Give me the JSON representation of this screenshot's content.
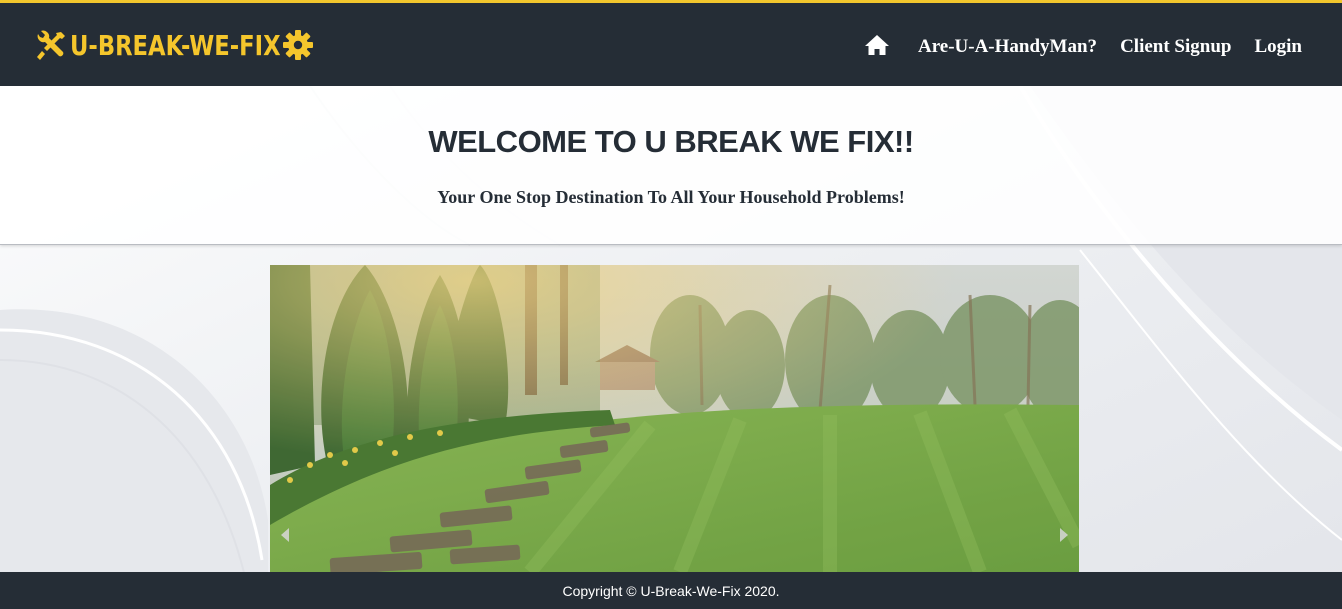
{
  "brand": {
    "name": "U-BREAK-WE-FIX",
    "accent_color": "#f5c62c",
    "left_icon": "tools-icon",
    "right_icon": "gear-icon"
  },
  "nav": {
    "home_icon": "home-icon",
    "items": [
      {
        "label": "Are-U-A-HandyMan?"
      },
      {
        "label": "Client Signup"
      },
      {
        "label": "Login"
      }
    ]
  },
  "hero": {
    "title": "WELCOME TO U BREAK WE FIX!!",
    "subtitle": "Your One Stop Destination To All Your Household Problems!"
  },
  "carousel": {
    "slide_image": "garden-lawn-photo",
    "prev_icon": "chevron-left-icon",
    "next_icon": "chevron-right-icon"
  },
  "footer": {
    "copyright": "Copyright © U-Break-We-Fix 2020."
  },
  "colors": {
    "navbar_bg": "#252d36",
    "accent": "#f2c62d",
    "text_dark": "#252d36"
  }
}
